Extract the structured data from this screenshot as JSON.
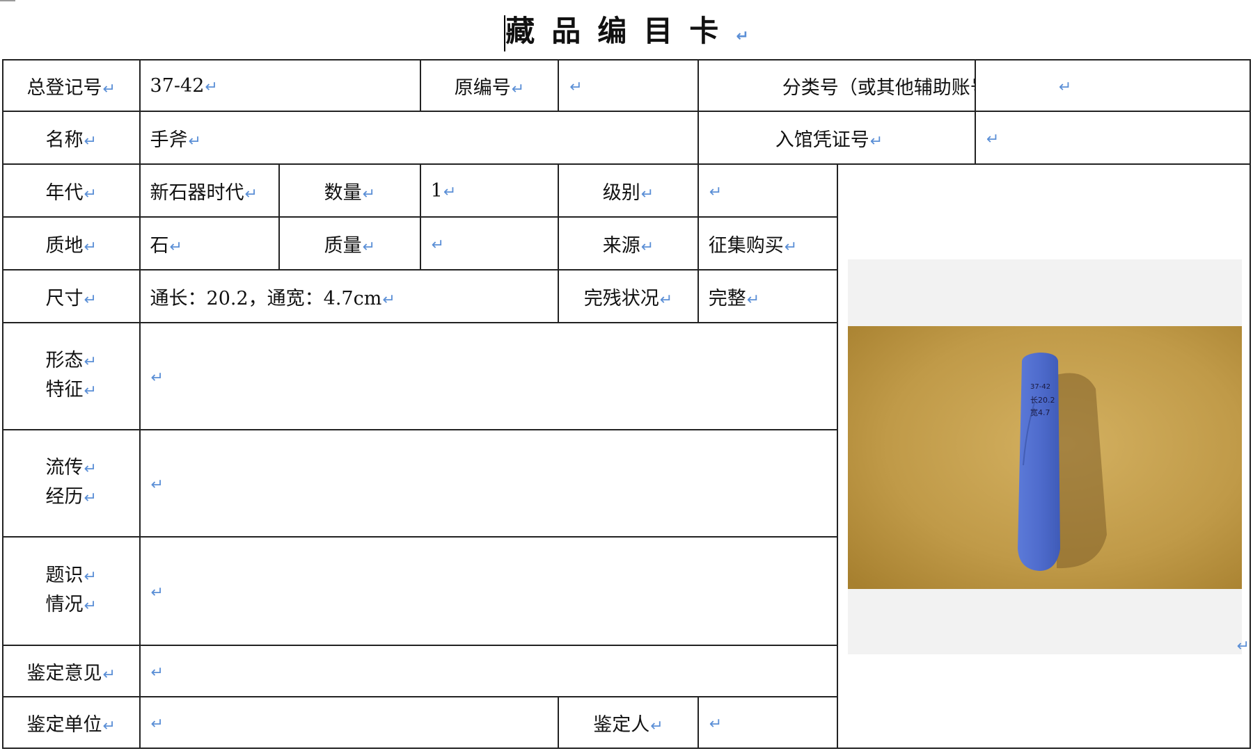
{
  "title": "藏品编目卡",
  "return_mark": "↵",
  "fields": {
    "total_reg_no": {
      "label": "总登记号",
      "value": "37-42"
    },
    "original_no": {
      "label": "原编号",
      "value": ""
    },
    "classification_no": {
      "label": "分类号（或其他辅助账号）",
      "value": ""
    },
    "name": {
      "label": "名称",
      "value": "手斧"
    },
    "entry_voucher_no": {
      "label": "入馆凭证号",
      "value": ""
    },
    "era": {
      "label": "年代",
      "value": "新石器时代"
    },
    "quantity": {
      "label": "数量",
      "value": "1"
    },
    "grade": {
      "label": "级别",
      "value": ""
    },
    "material": {
      "label": "质地",
      "value": "石"
    },
    "weight": {
      "label": "质量",
      "value": ""
    },
    "source": {
      "label": "来源",
      "value": "征集购买"
    },
    "size": {
      "label": "尺寸",
      "value": "通长：20.2，通宽：4.7cm"
    },
    "condition": {
      "label": "完残状况",
      "value": "完整"
    },
    "morphology": {
      "label_line1": "形态",
      "label_line2": "特征",
      "value": ""
    },
    "provenance": {
      "label_line1": "流传",
      "label_line2": "经历",
      "value": ""
    },
    "inscriptions": {
      "label_line1": "题识",
      "label_line2": "情况",
      "value": ""
    },
    "appraisal_opinion": {
      "label": "鉴定意见",
      "value": ""
    },
    "appraisal_unit": {
      "label": "鉴定单位",
      "value": ""
    },
    "appraiser": {
      "label": "鉴定人",
      "value": ""
    }
  },
  "photo": {
    "subject": "blue stone hand axe on tan background",
    "inscription_lines": [
      "37-42",
      "长20.2",
      "宽4.7"
    ],
    "colors": {
      "background": "#c09a48",
      "stone": "#4f6ccd",
      "shadow": "#7f5f28"
    }
  }
}
